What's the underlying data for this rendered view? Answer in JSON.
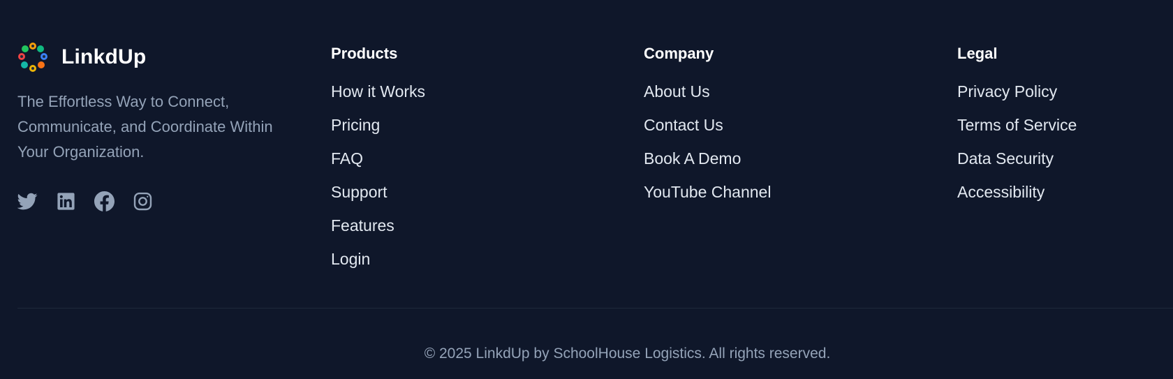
{
  "brand": {
    "name": "LinkdUp",
    "tagline": "The Effortless Way to Connect,\nCommunicate, and Coordinate Within\nYour Organization."
  },
  "socials": [
    {
      "icon": "twitter-icon"
    },
    {
      "icon": "linkedin-icon"
    },
    {
      "icon": "facebook-icon"
    },
    {
      "icon": "instagram-icon"
    }
  ],
  "columns": [
    {
      "title": "Products",
      "links": [
        "How it Works",
        "Pricing",
        "FAQ",
        "Support",
        "Features",
        "Login"
      ]
    },
    {
      "title": "Company",
      "links": [
        "About Us",
        "Contact Us",
        "Book A Demo",
        "YouTube Channel"
      ]
    },
    {
      "title": "Legal",
      "links": [
        "Privacy Policy",
        "Terms of Service",
        "Data Security",
        "Accessibility"
      ]
    }
  ],
  "copyright": "© 2025 LinkdUp by SchoolHouse Logistics. All rights reserved.",
  "colors": {
    "background": "#0f172a",
    "heading": "#ffffff",
    "link": "#e2e8f0",
    "muted": "#94a3b8",
    "divider": "#1e293b"
  }
}
